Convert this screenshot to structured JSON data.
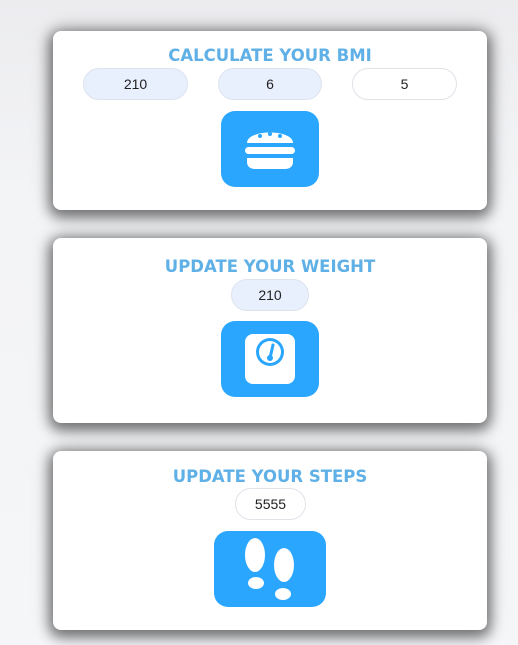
{
  "bmi": {
    "title": "CALCULATE YOUR BMI",
    "weight_value": "210",
    "feet_value": "6",
    "inches_value": "5",
    "icon": "burger-icon"
  },
  "weight": {
    "title": "UPDATE YOUR WEIGHT",
    "value": "210",
    "icon": "scale-icon"
  },
  "steps": {
    "title": "UPDATE YOUR STEPS",
    "value": "5555",
    "icon": "footprints-icon"
  },
  "colors": {
    "title": "#5fb0e6",
    "button": "#2aa6ff",
    "filled_input": "#e8f0fe"
  }
}
